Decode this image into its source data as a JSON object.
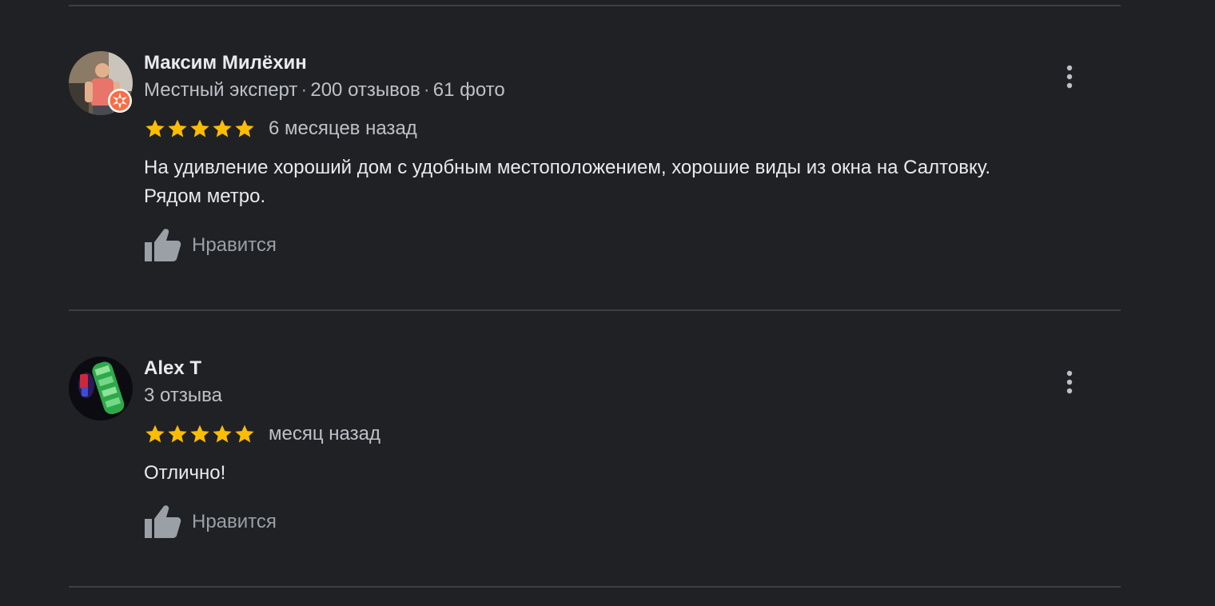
{
  "reviews": [
    {
      "author": "Максим Милёхин",
      "meta": [
        "Местный эксперт",
        "200 отзывов",
        "61 фото"
      ],
      "meta_separator": "·",
      "rating": 5,
      "rating_max": 5,
      "time": "6 месяцев назад",
      "text_lines": [
        "На удивление хороший дом с удобным местоположением, хорошие виды из окна на Салтовку.",
        "Рядом метро."
      ],
      "like_label": "Нравится",
      "local_guide_badge": true,
      "menu_icon": "more-vert-icon"
    },
    {
      "author": "Alex T",
      "meta": [
        "3 отзыва"
      ],
      "meta_separator": "·",
      "rating": 5,
      "rating_max": 5,
      "time": "месяц назад",
      "text_lines": [
        "Отлично!"
      ],
      "like_label": "Нравится",
      "local_guide_badge": false,
      "menu_icon": "more-vert-icon"
    }
  ],
  "colors": {
    "background": "#202124",
    "divider": "#3c4043",
    "star": "#fbbc04",
    "badge": "#f96e46",
    "secondary_text": "#bdc1c6",
    "icon": "#9aa0a6"
  }
}
